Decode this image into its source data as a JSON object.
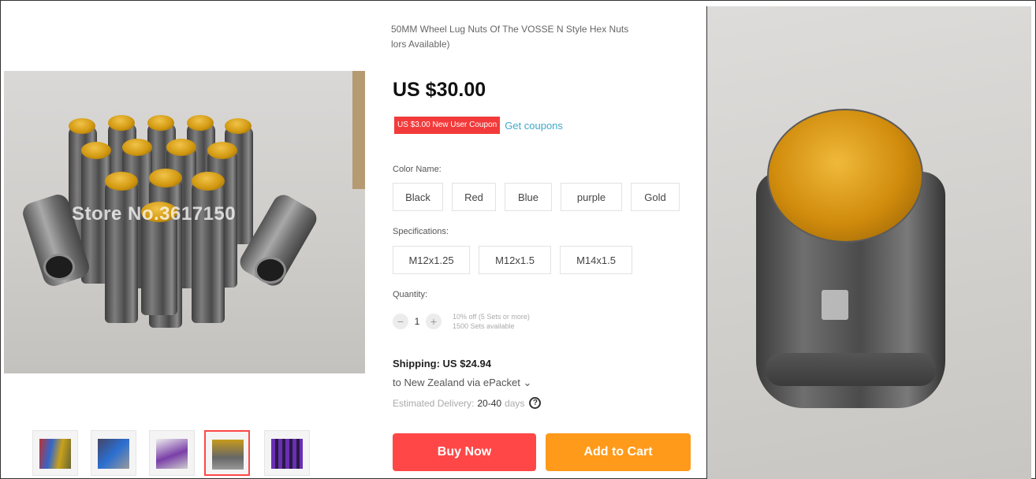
{
  "product": {
    "title_line1": "50MM Wheel Lug Nuts Of The VOSSE N Style Hex Nuts",
    "title_line2": "lors Available)",
    "price": "US $30.00",
    "coupon_badge": "US $3.00 New User Coupon",
    "get_coupons": "Get coupons"
  },
  "gallery": {
    "watermark": "Store No.3617150",
    "thumbnails": [
      "thumb-1",
      "thumb-2",
      "thumb-3",
      "thumb-4",
      "thumb-5"
    ],
    "active_thumbnail": 3
  },
  "options": {
    "color_label": "Color Name:",
    "colors": [
      "Black",
      "Red",
      "Blue",
      "purple",
      "Gold"
    ],
    "spec_label": "Specifications:",
    "specs": [
      "M12x1.25",
      "M12x1.5",
      "M14x1.5"
    ]
  },
  "quantity": {
    "label": "Quantity:",
    "minus": "−",
    "value": "1",
    "plus": "+",
    "note_line1": "10% off (5 Sets or more)",
    "note_line2": "1500 Sets available"
  },
  "shipping": {
    "title": "Shipping: US $24.94",
    "destination": "to New Zealand via ePacket ⌄",
    "estimated_label": "Estimated Delivery:",
    "days_value": "20-40",
    "days_unit": "days",
    "help_icon": "?"
  },
  "actions": {
    "buy_now": "Buy Now",
    "add_to_cart": "Add to Cart"
  },
  "colors": {
    "accent_red": "#ff4747",
    "accent_orange": "#ff9a1a",
    "link_blue": "#3fa9c9",
    "gold": "#d39a12"
  }
}
